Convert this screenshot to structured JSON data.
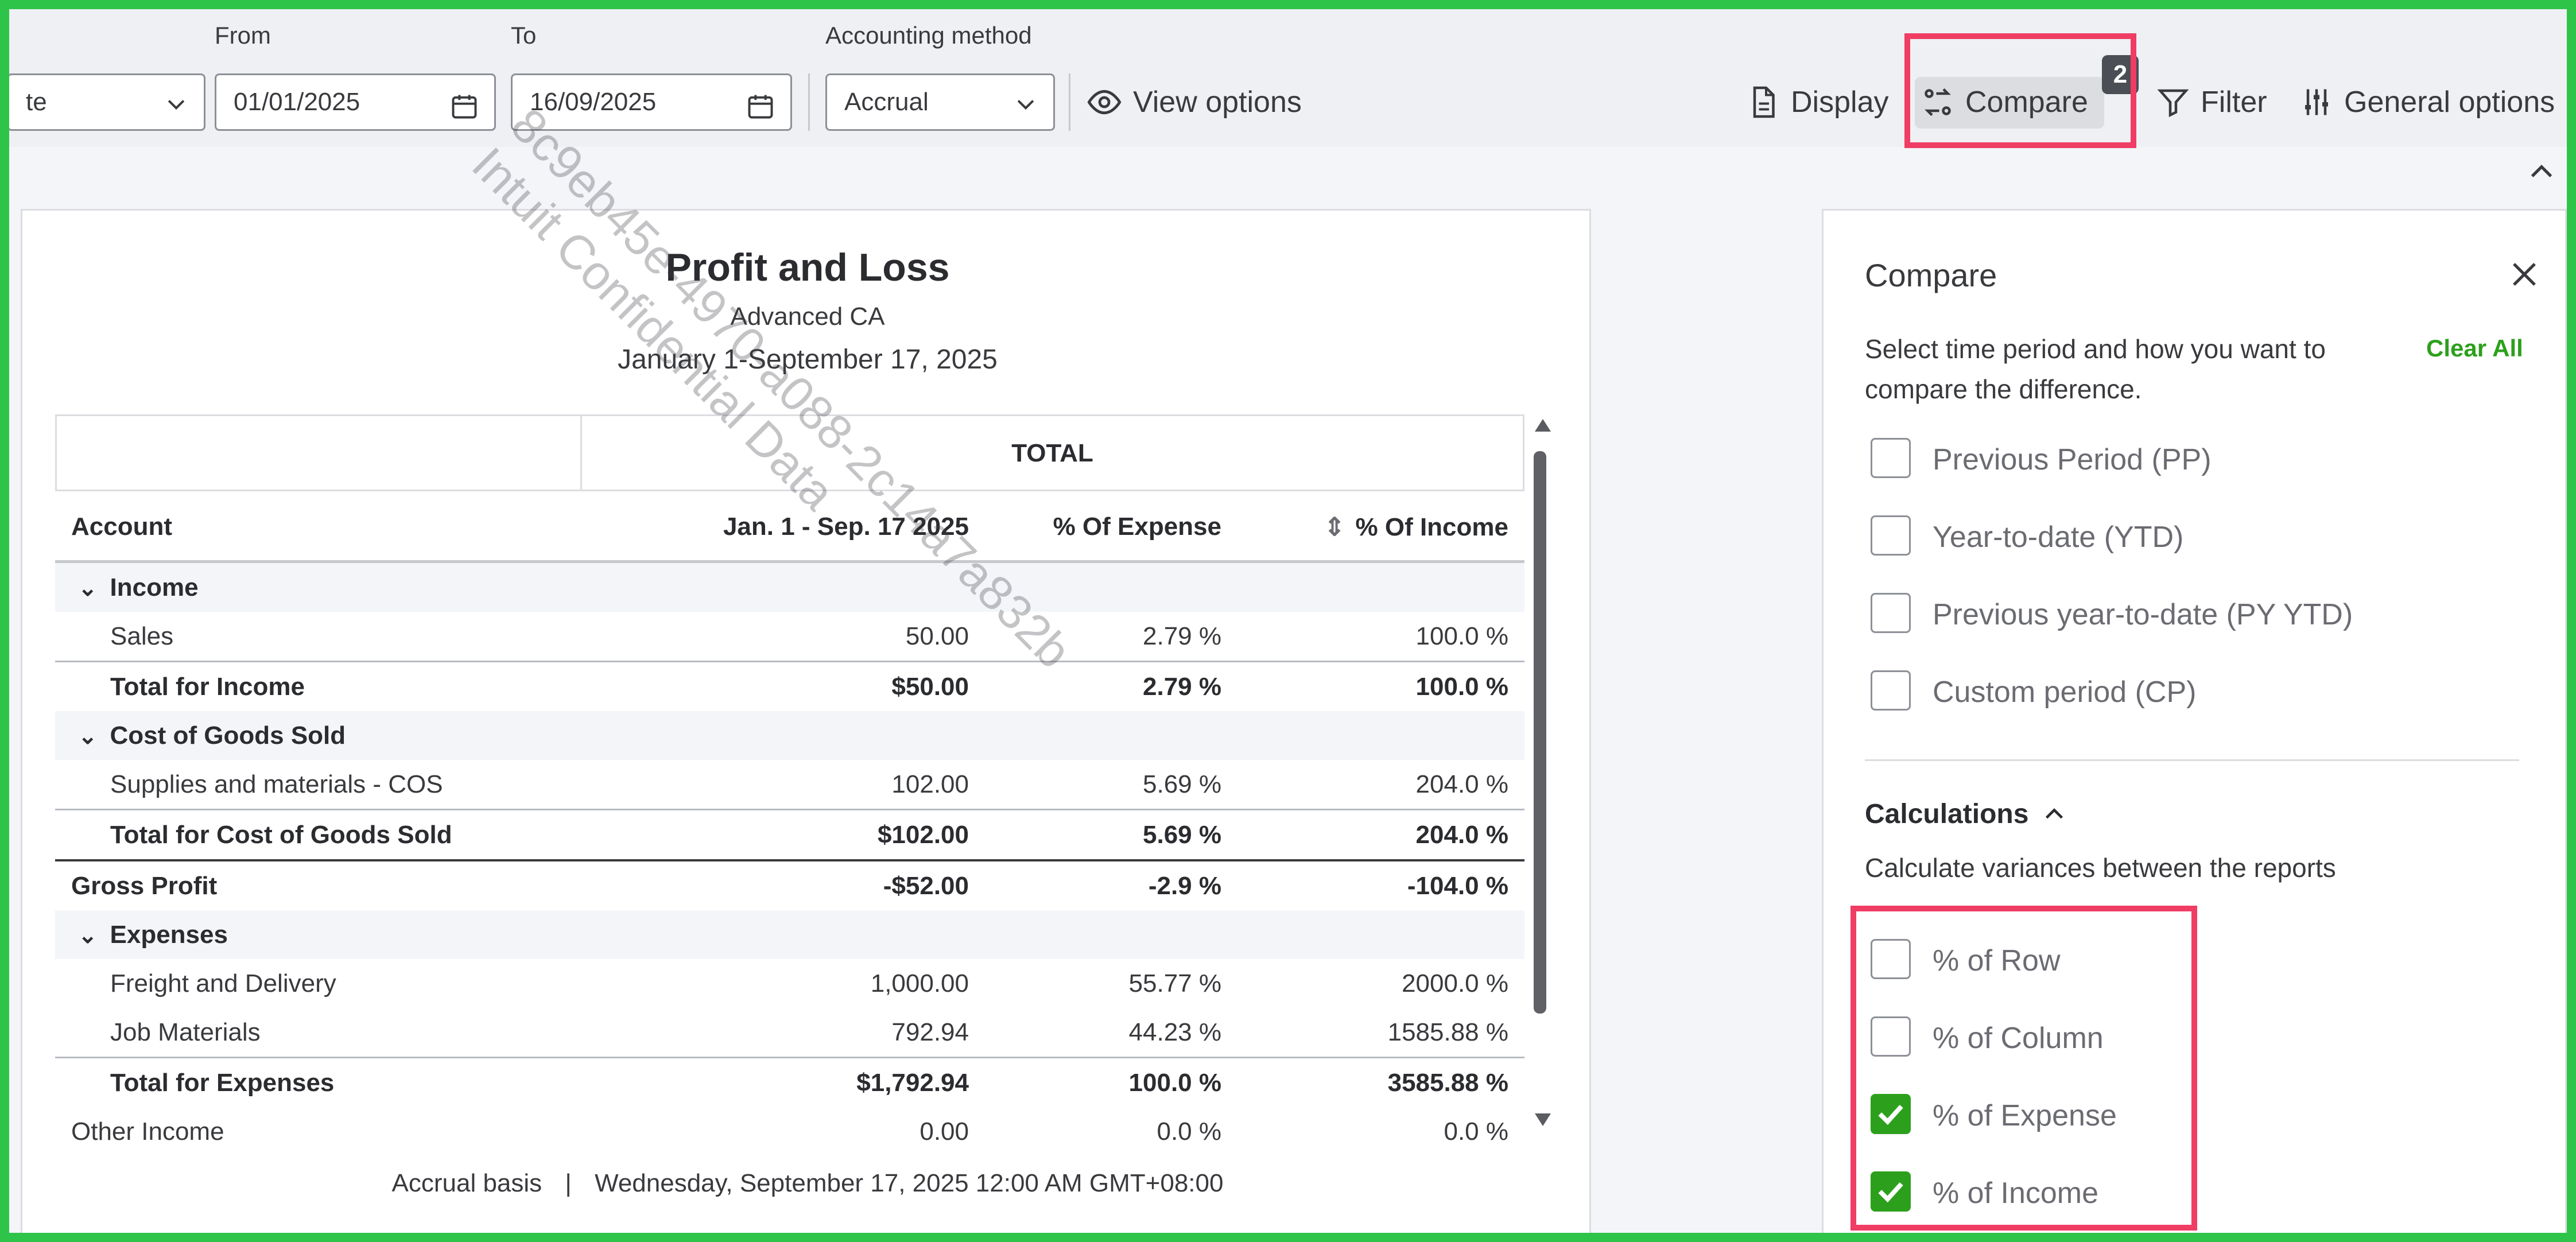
{
  "toolbar": {
    "date_field_partial": "te",
    "from_label": "From",
    "from_value": "01/01/2025",
    "to_label": "To",
    "to_value": "16/09/2025",
    "method_label": "Accounting method",
    "method_value": "Accrual",
    "view_options": "View options",
    "display": "Display",
    "compare": "Compare",
    "compare_badge": "2",
    "filter": "Filter",
    "general_options": "General options"
  },
  "report": {
    "title": "Profit and Loss",
    "company": "Advanced CA",
    "period": "January 1-September 17, 2025",
    "watermark_line1": "8c9eb45e-4970-a088-2c14a7a832b",
    "watermark_line2": "Intuit Confidential Data",
    "total_header": "TOTAL",
    "columns": [
      "Account",
      "Jan. 1 - Sep. 17 2025",
      "% Of Expense",
      "% Of Income"
    ],
    "rows": [
      {
        "label": "Income",
        "type": "section",
        "values": [
          "",
          "",
          ""
        ]
      },
      {
        "label": "Sales",
        "type": "row",
        "values": [
          "50.00",
          "2.79 %",
          "100.0 %"
        ]
      },
      {
        "label": "Total for Income",
        "type": "total",
        "values": [
          "$50.00",
          "2.79 %",
          "100.0 %"
        ]
      },
      {
        "label": "Cost of Goods Sold",
        "type": "section",
        "values": [
          "",
          "",
          ""
        ]
      },
      {
        "label": "Supplies and materials - COS",
        "type": "row",
        "values": [
          "102.00",
          "5.69 %",
          "204.0 %"
        ]
      },
      {
        "label": "Total for Cost of Goods Sold",
        "type": "total",
        "values": [
          "$102.00",
          "5.69 %",
          "204.0 %"
        ]
      },
      {
        "label": "Gross Profit",
        "type": "summary",
        "values": [
          "-$52.00",
          "-2.9 %",
          "-104.0 %"
        ]
      },
      {
        "label": "Expenses",
        "type": "section",
        "values": [
          "",
          "",
          ""
        ]
      },
      {
        "label": "Freight and Delivery",
        "type": "row",
        "values": [
          "1,000.00",
          "55.77 %",
          "2000.0 %"
        ]
      },
      {
        "label": "Job Materials",
        "type": "row",
        "values": [
          "792.94",
          "44.23 %",
          "1585.88 %"
        ]
      },
      {
        "label": "Total for Expenses",
        "type": "total",
        "values": [
          "$1,792.94",
          "100.0 %",
          "3585.88 %"
        ]
      },
      {
        "label": "Other Income",
        "type": "summary-plain",
        "values": [
          "0.00",
          "0.0 %",
          "0.0 %"
        ]
      }
    ],
    "footer_basis": "Accrual basis",
    "footer_date": "Wednesday, September 17, 2025 12:00 AM GMT+08:00"
  },
  "compare_panel": {
    "title": "Compare",
    "description_line1": "Select time period and how you want to",
    "description_line2": "compare the difference.",
    "clear_all": "Clear All",
    "periods": [
      {
        "label": "Previous Period (PP)",
        "checked": false
      },
      {
        "label": "Year-to-date (YTD)",
        "checked": false
      },
      {
        "label": "Previous year-to-date (PY YTD)",
        "checked": false
      },
      {
        "label": "Custom period (CP)",
        "checked": false
      }
    ],
    "calculations_title": "Calculations",
    "calculations_desc": "Calculate variances between the reports",
    "calculations": [
      {
        "label": "% of Row",
        "checked": false
      },
      {
        "label": "% of Column",
        "checked": false
      },
      {
        "label": "% of Expense",
        "checked": true
      },
      {
        "label": "% of Income",
        "checked": true
      }
    ]
  },
  "colors": {
    "accent_green": "#2ca01c",
    "highlight": "#ef3d64",
    "frame": "#2ec44a"
  }
}
